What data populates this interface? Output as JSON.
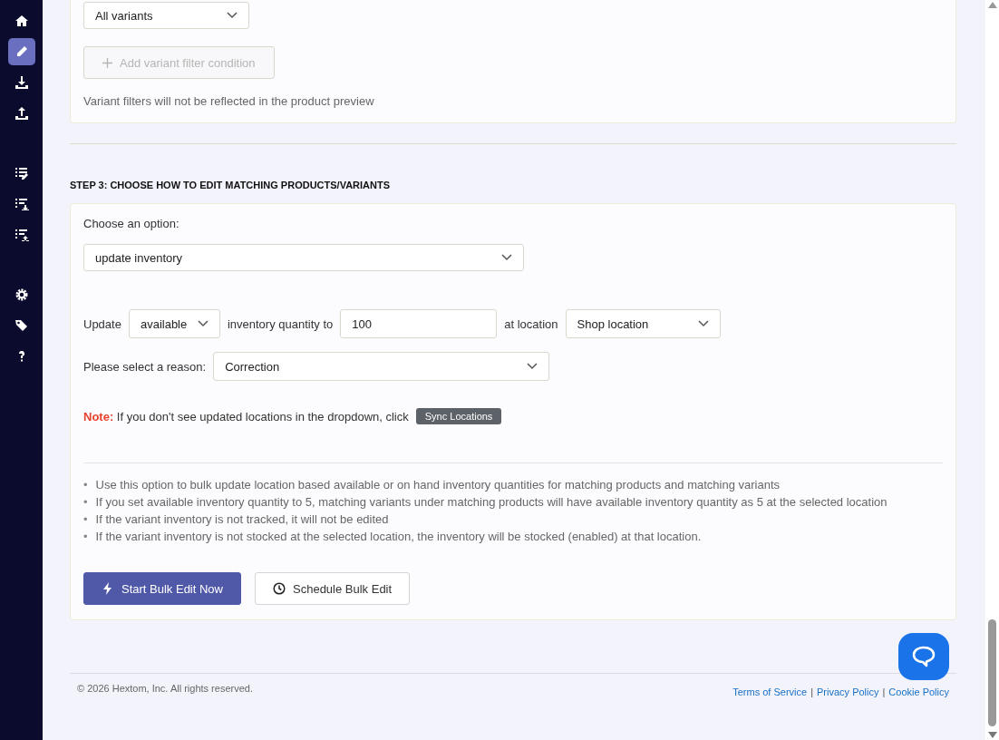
{
  "sidebar": {
    "items": [
      {
        "kind": "home",
        "selected": false
      },
      {
        "kind": "pencil",
        "selected": true
      },
      {
        "kind": "download",
        "selected": false
      },
      {
        "kind": "upload",
        "selected": false
      },
      {
        "kind": "list-edit",
        "selected": false
      },
      {
        "kind": "list-download",
        "selected": false
      },
      {
        "kind": "list-upload",
        "selected": false
      },
      {
        "kind": "gear",
        "selected": false
      },
      {
        "kind": "tags",
        "selected": false
      },
      {
        "kind": "help",
        "selected": false
      }
    ]
  },
  "variant_filter": {
    "select": "All variants",
    "add_button": {
      "label": "Add variant filter condition",
      "disabled": true
    },
    "note": "Variant filters will not be reflected in the product preview"
  },
  "step3": {
    "heading": "STEP 3: CHOOSE HOW TO EDIT MATCHING PRODUCTS/VARIANTS",
    "option_label": "Choose an option:",
    "option_select": "update inventory",
    "update_row": {
      "label": "Update",
      "type_select": "available",
      "mid_label": "inventory quantity to",
      "quantity": "100",
      "location_label": "at location",
      "location_select": "Shop location"
    },
    "reason": {
      "label": "Please select a reason:",
      "select": "Correction"
    },
    "note": {
      "prefix": "Note:",
      "text": "If you don't see updated locations in the dropdown, click",
      "button": "Sync Locations"
    },
    "tip_bullet": "•",
    "tips": [
      "Use this option to bulk update location based available or on hand inventory quantities for matching products and matching variants",
      "If you set available inventory quantity to 5, matching variants under matching products will have available inventory quantity as 5 at the selected location",
      "If the variant inventory is not tracked, it will not be edited",
      "If the variant inventory is not stocked at the selected location, the inventory will be stocked (enabled) at that location."
    ],
    "buttons": [
      {
        "kind": "primary",
        "label": "Start Bulk Edit Now"
      },
      {
        "kind": "secondary",
        "label": "Schedule Bulk Edit"
      }
    ]
  },
  "footer": {
    "copyright": "© 2026 Hextom, Inc. All rights reserved.",
    "links": [
      "Terms of Service",
      "Privacy Policy",
      "Cookie Policy"
    ],
    "separator": "|"
  }
}
